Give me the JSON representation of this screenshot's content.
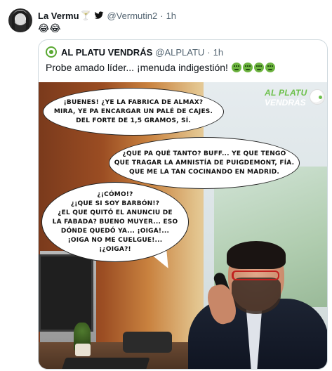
{
  "tweet": {
    "author_name": "La Vermu",
    "name_emoji": "🍸",
    "verified_icon": "twitter-bird-icon",
    "handle": "@Vermutin2",
    "separator": "·",
    "time": "1h",
    "text": "😂😂"
  },
  "quoted": {
    "author_name": "AL PLATU VENDRÁS",
    "handle": "@ALPLATU",
    "separator": "·",
    "time": "1h",
    "text": "Probe amado líder... ¡menuda indigestión!",
    "emoji_count": 4,
    "emoji_icon": "nauseated-face-icon"
  },
  "comic": {
    "logo_line1": "AL PLATU",
    "logo_line2": "VENDRÁS",
    "bubble1": "¡BUENES! ¿YE LA FABRICA DE ALMAX?\nMIRA, YE PA ENCARGAR UN PALÉ DE CAJES.\nDEL FORTE DE 1,5 GRAMOS, SÍ.",
    "bubble2": "¿QUE PA QUÉ TANTO? BUFF... YE QUE TENGO\nQUE TRAGAR LA AMNISTÍA DE PUIGDEMONT, FÍA.\nQUE ME LA TAN COCINANDO EN MADRID.",
    "bubble3": "¿¡CÓMO!?\n¿¡QUE SI SOY BARBÓN!?\n¿EL QUE QUITÓ EL ANUNCIU DE\nLA FABADA? BUENO MUYER... ESO\nDÓNDE QUEDÓ YA... ¡OIGA!...\n¡OIGA NO ME CUELGUE!...\n¡¿OIGA?!"
  },
  "colors": {
    "text_primary": "#0f1419",
    "text_secondary": "#536471",
    "border": "#cfd9de",
    "brand_green": "#6cc04a",
    "twitter_blue": "#1d9bf0"
  }
}
